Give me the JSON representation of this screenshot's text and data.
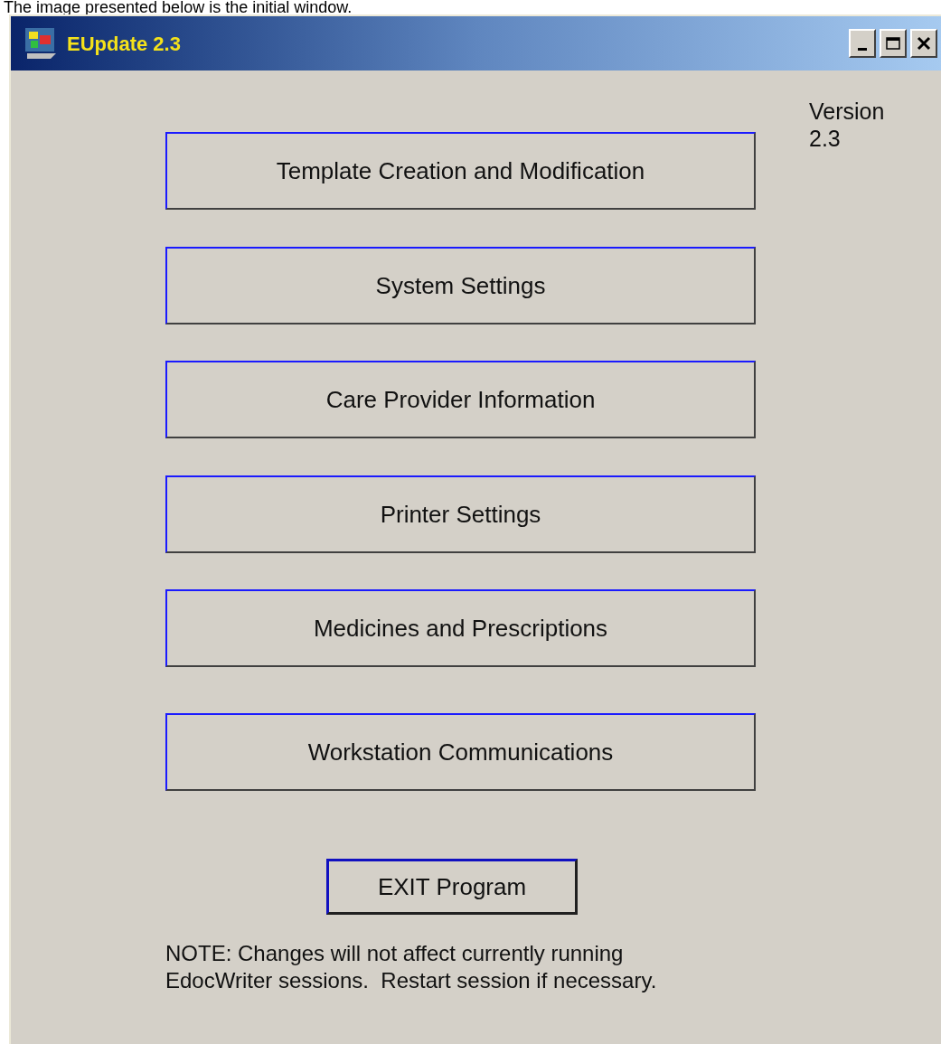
{
  "caption": "The image presented below is the initial window.",
  "window": {
    "title": "EUpdate 2.3"
  },
  "version": {
    "label": "Version",
    "number": "2.3"
  },
  "menu_buttons": [
    "Template Creation and Modification",
    "System Settings",
    "Care Provider Information",
    "Printer Settings",
    "Medicines and Prescriptions",
    "Workstation Communications"
  ],
  "exit_button": "EXIT Program",
  "note": "NOTE: Changes will not affect currently running\nEdocWriter sessions.  Restart session if necessary."
}
